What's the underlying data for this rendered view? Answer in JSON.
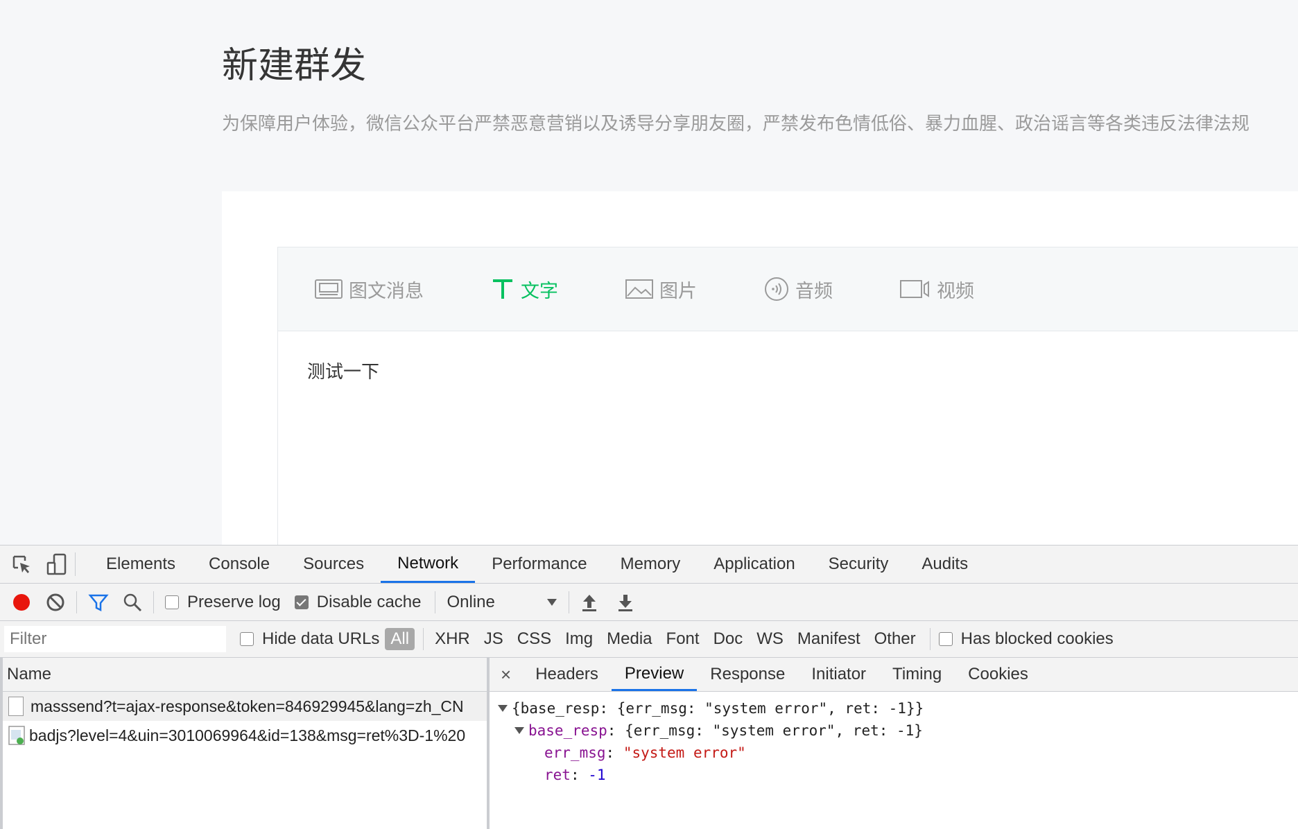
{
  "page": {
    "title": "新建群发",
    "description": "为保障用户体验，微信公众平台严禁恶意营销以及诱导分享朋友圈，严禁发布色情低俗、暴力血腥、政治谣言等各类违反法律法规"
  },
  "editor": {
    "tabs": [
      {
        "label": "图文消息",
        "icon": "news-icon"
      },
      {
        "label": "文字",
        "icon": "text-icon",
        "active": true
      },
      {
        "label": "图片",
        "icon": "image-icon"
      },
      {
        "label": "音频",
        "icon": "audio-icon"
      },
      {
        "label": "视频",
        "icon": "video-icon"
      }
    ],
    "content": "测试一下",
    "accent_color": "#07c160"
  },
  "devtools": {
    "tabs": [
      "Elements",
      "Console",
      "Sources",
      "Network",
      "Performance",
      "Memory",
      "Application",
      "Security",
      "Audits"
    ],
    "active_tab": "Network",
    "toolbar": {
      "preserve_log": "Preserve log",
      "disable_cache": "Disable cache",
      "throttle": "Online"
    },
    "filterbar": {
      "placeholder": "Filter",
      "hide_data_urls": "Hide data URLs",
      "types": [
        "All",
        "XHR",
        "JS",
        "CSS",
        "Img",
        "Media",
        "Font",
        "Doc",
        "WS",
        "Manifest",
        "Other"
      ],
      "blocked_cookies": "Has blocked cookies"
    },
    "requests": {
      "header": "Name",
      "rows": [
        "masssend?t=ajax-response&token=846929945&lang=zh_CN",
        "badjs?level=4&uin=3010069964&id=138&msg=ret%3D-1%20"
      ]
    },
    "detail": {
      "close": "×",
      "tabs": [
        "Headers",
        "Preview",
        "Response",
        "Initiator",
        "Timing",
        "Cookies"
      ],
      "active_tab": "Preview",
      "preview": {
        "line1": "{base_resp: {err_msg: \"system error\", ret: -1}}",
        "line2_key": "base_resp",
        "line2_val": ": {err_msg: \"system error\", ret: -1}",
        "err_msg_key": "err_msg",
        "err_msg_val": "\"system error\"",
        "ret_key": "ret",
        "ret_val": "-1"
      }
    }
  }
}
